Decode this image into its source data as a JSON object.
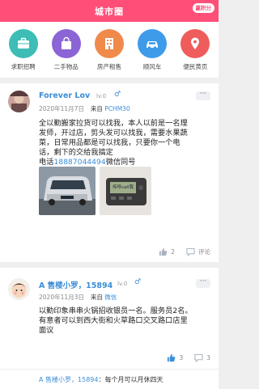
{
  "header": {
    "title": "城市圈",
    "points_label": "赢积分"
  },
  "categories": [
    {
      "label": "求职招聘",
      "icon": "briefcase-icon",
      "color": "#3dbdb6"
    },
    {
      "label": "二手物品",
      "icon": "shopping-bag-icon",
      "color": "#8b64d6"
    },
    {
      "label": "房产租售",
      "icon": "building-icon",
      "color": "#f08a4b"
    },
    {
      "label": "顺风车",
      "icon": "car-icon",
      "color": "#3e9be9"
    },
    {
      "label": "便民黄页",
      "icon": "map-pin-icon",
      "color": "#ef5c5c"
    }
  ],
  "posts": [
    {
      "username": "Forever  Lov",
      "level": "lv.0",
      "gender": "♂",
      "date": "2020年11月7日",
      "source_prefix": "来自",
      "device": "PCHM30",
      "more": "···",
      "text_lines": [
        "全以勤搬家拉货可以找我，本人以前是一名理",
        "发师，开过店，剪头发可以找我，需要水果蔬",
        "菜，日常用品都是可以找我，只要你一个电",
        "话，剩下的交给我搞定"
      ],
      "phone_prefix": "电话",
      "phone": "18887044494",
      "phone_suffix": "微信同号",
      "like_count": "2",
      "comment_label": "评论"
    },
    {
      "username": "A 售楼小罗，15894",
      "level": "lv.0",
      "gender": "♂",
      "date": "2020年11月3日",
      "source_prefix": "来自",
      "device": "微信",
      "more": "···",
      "text_lines": [
        "以勤印象串串火锅招收银员一名。服务员2名。",
        "有意者可以到西大街和火草路口交叉路口店里",
        "面议"
      ],
      "like_count": "3",
      "comment_count": "3",
      "reply_name": "A 售楼小罗，15894",
      "reply_text": "：每个月可以月休四天"
    }
  ],
  "pager_text": "传呼call我"
}
